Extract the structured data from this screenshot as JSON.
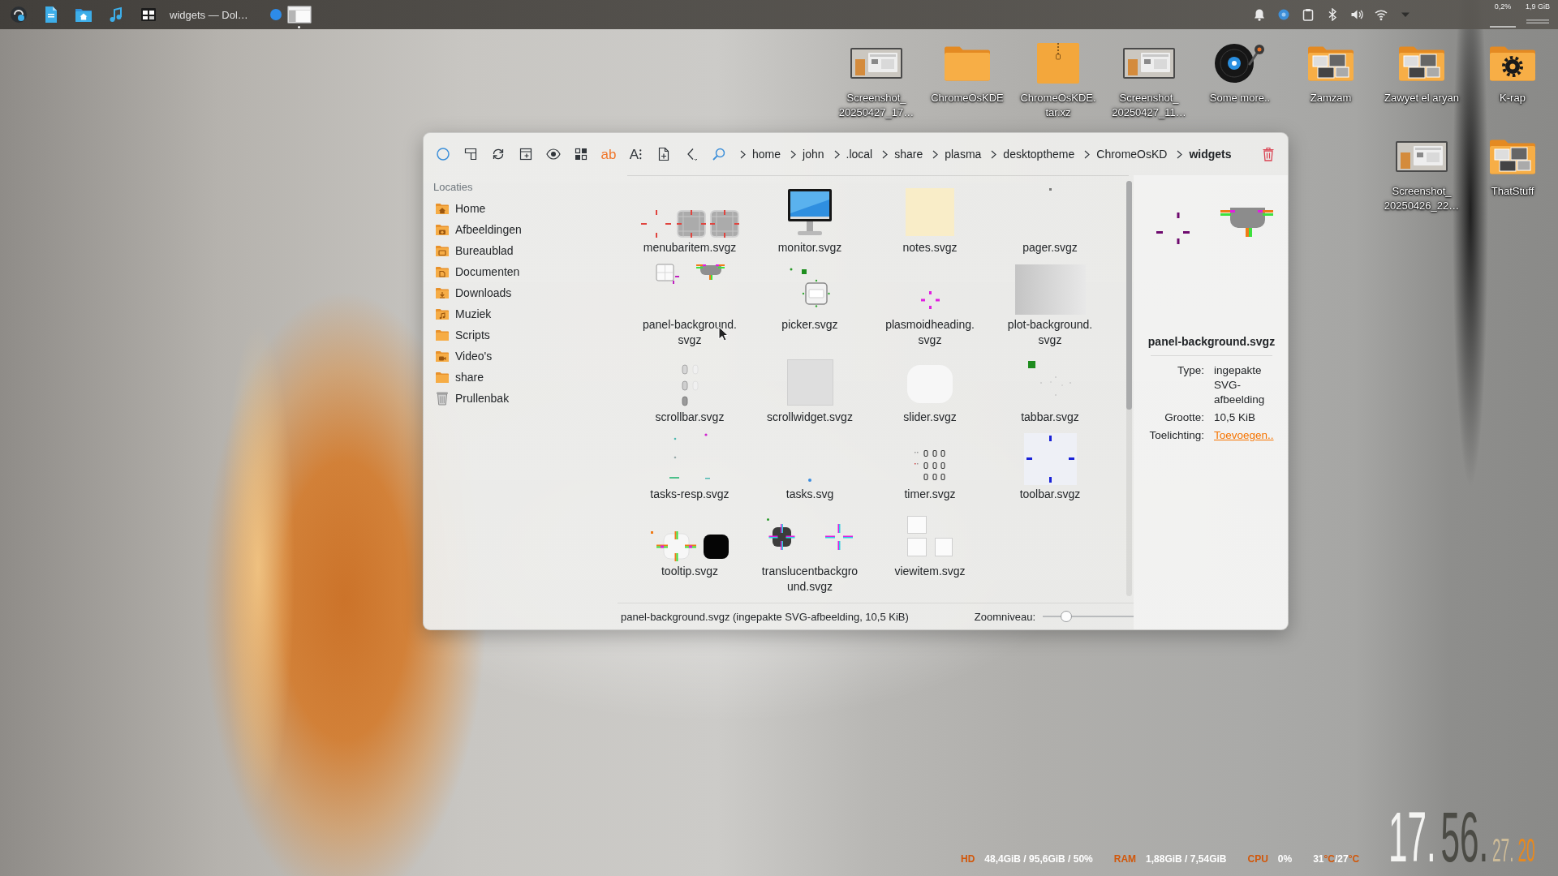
{
  "panel": {
    "task_title": "widgets — Dol…",
    "readings": [
      "0,2%",
      "1,9 GiB"
    ]
  },
  "desktop_icons": [
    [
      {
        "label": "Screenshot_20250427_17…",
        "kind": "screenshot"
      },
      {
        "label": "ChromeOsKDE",
        "kind": "folder"
      },
      {
        "label": "ChromeOsKDE.tar.xz",
        "kind": "archive"
      },
      {
        "label": "Screenshot_20250427_11…",
        "kind": "screenshot"
      },
      {
        "label": "Some more..",
        "kind": "record-player"
      },
      {
        "label": "Zamzam",
        "kind": "photo-folder"
      },
      {
        "label": "Zawyet el aryan",
        "kind": "photo-folder"
      },
      {
        "label": "K-rap",
        "kind": "gear-folder"
      }
    ],
    [
      {
        "label": "Screenshot_20250426_22…",
        "kind": "screenshot"
      },
      {
        "label": "ThatStuff",
        "kind": "photo-folder"
      }
    ]
  ],
  "file_manager": {
    "toolbar": [
      {
        "kind": "circle"
      },
      {
        "kind": "split"
      },
      {
        "kind": "reload"
      },
      {
        "kind": "window-plus"
      },
      {
        "kind": "eye"
      },
      {
        "kind": "grid"
      },
      {
        "kind": "glyph-accent",
        "glyph": "ab"
      },
      {
        "kind": "glyph",
        "glyph": "A⁝"
      },
      {
        "kind": "document-plus"
      },
      {
        "kind": "back"
      },
      {
        "kind": "search"
      }
    ],
    "breadcrumbs": [
      {
        "label": "home",
        "selected": false
      },
      {
        "label": "john",
        "selected": false
      },
      {
        "label": ".local",
        "selected": false
      },
      {
        "label": "share",
        "selected": false
      },
      {
        "label": "plasma",
        "selected": false
      },
      {
        "label": "desktoptheme",
        "selected": false
      },
      {
        "label": "ChromeOsKD",
        "selected": false
      },
      {
        "label": "widgets",
        "selected": true
      }
    ],
    "sidebar": {
      "heading": "Locaties",
      "items": [
        {
          "label": "Home",
          "kind": "home",
          "selected": false
        },
        {
          "label": "Afbeeldingen",
          "kind": "pictures",
          "selected": false
        },
        {
          "label": "Bureaublad",
          "kind": "desktop",
          "selected": false
        },
        {
          "label": "Documenten",
          "kind": "documents",
          "selected": false
        },
        {
          "label": "Downloads",
          "kind": "downloads",
          "selected": false
        },
        {
          "label": "Muziek",
          "kind": "music",
          "selected": false
        },
        {
          "label": "Scripts",
          "kind": "folder",
          "selected": false
        },
        {
          "label": "Video's",
          "kind": "videos",
          "selected": false
        },
        {
          "label": "share",
          "kind": "folder",
          "selected": false
        },
        {
          "label": "Prullenbak",
          "kind": "trash",
          "selected": false
        }
      ]
    },
    "files": [
      {
        "name": "menubaritem.svgz",
        "kind": "crop-marks",
        "selected": false
      },
      {
        "name": "monitor.svgz",
        "kind": "monitor",
        "selected": false
      },
      {
        "name": "notes.svgz",
        "kind": "note",
        "selected": false
      },
      {
        "name": "pager.svgz",
        "kind": "dot",
        "selected": false
      },
      {
        "name": "panel-background.svgz",
        "kind": "frame-panel",
        "selected": false
      },
      {
        "name": "picker.svgz",
        "kind": "picker",
        "selected": false
      },
      {
        "name": "plasmoidheading.svgz",
        "kind": "crosshair",
        "selected": false
      },
      {
        "name": "plot-background.svgz",
        "kind": "gradient",
        "selected": false
      },
      {
        "name": "scrollbar.svgz",
        "kind": "capsules",
        "selected": false
      },
      {
        "name": "scrollwidget.svgz",
        "kind": "square",
        "selected": false
      },
      {
        "name": "slider.svgz",
        "kind": "rounded",
        "selected": false
      },
      {
        "name": "tabbar.svgz",
        "kind": "tab-marks",
        "selected": false
      },
      {
        "name": "tasks-resp.svgz",
        "kind": "scatter",
        "selected": false
      },
      {
        "name": "tasks.svg",
        "kind": "small-dot",
        "selected": false
      },
      {
        "name": "timer.svgz",
        "kind": "digits",
        "selected": false
      },
      {
        "name": "toolbar.svgz",
        "kind": "edge-marks",
        "selected": false
      },
      {
        "name": "tooltip.svgz",
        "kind": "tooltip",
        "selected": false
      },
      {
        "name": "translucentbackground.svgz",
        "kind": "translucent",
        "selected": false
      },
      {
        "name": "viewitem.svgz",
        "kind": "tiles",
        "selected": false
      }
    ],
    "info_panel": {
      "preview": {
        "kind": "crosshair-panel"
      },
      "title": "panel-background.svgz",
      "details": [
        {
          "label": "Type:",
          "value": "ingepakte SVG-afbeelding",
          "kind": "text"
        },
        {
          "label": "Grootte:",
          "value": "10,5 KiB",
          "kind": "text"
        },
        {
          "label": "Toelichting:",
          "value": "Toevoegen..",
          "kind": "link"
        }
      ]
    },
    "status_bar": {
      "text": "panel-background.svgz (ingepakte SVG-afbeelding, 10,5 KiB)",
      "zoom_label": "Zoomniveau:",
      "zoom_slider": {
        "level": 0.26
      }
    }
  },
  "system_monitor": {
    "stats": [
      {
        "label": "HD",
        "value": "48,4GiB / 95,6GiB / 50%"
      },
      {
        "label": "RAM",
        "value": "1,88GiB / 7,54GiB"
      },
      {
        "label": "CPU",
        "value": "0%"
      }
    ],
    "temperature": [
      {
        "text": "31",
        "kind": "value"
      },
      {
        "text": "°C",
        "kind": "unit"
      },
      {
        "text": "/27",
        "kind": "value"
      },
      {
        "text": "°C",
        "kind": "unit"
      }
    ]
  },
  "clock": [
    {
      "text": "17.",
      "kind": "large",
      "color": "#f4f4f2"
    },
    {
      "text": "56.",
      "kind": "large",
      "color": "#4b4b45"
    },
    {
      "text": "27.",
      "kind": "small",
      "color": "#cdbb98"
    },
    {
      "text": "20",
      "kind": "small",
      "color": "#e8891e"
    }
  ]
}
